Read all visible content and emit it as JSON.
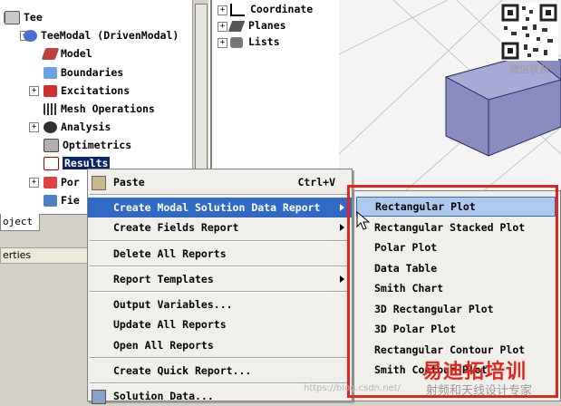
{
  "tree": {
    "items": [
      {
        "label": "Tee",
        "icon": "project-icon"
      },
      {
        "label": "TeeModal (DrivenModal)",
        "icon": "design-icon"
      },
      {
        "label": "Model",
        "icon": "model-icon"
      },
      {
        "label": "Boundaries",
        "icon": "boundaries-icon"
      },
      {
        "label": "Excitations",
        "icon": "excitations-icon"
      },
      {
        "label": "Mesh Operations",
        "icon": "mesh-icon"
      },
      {
        "label": "Analysis",
        "icon": "analysis-icon"
      },
      {
        "label": "Optimetrics",
        "icon": "optimetrics-icon"
      },
      {
        "label": "Results",
        "icon": "results-icon"
      },
      {
        "label": "Por",
        "icon": "port-icon"
      },
      {
        "label": "Fie",
        "icon": "field-icon"
      }
    ],
    "tab_label": "oject",
    "properties_label": "erties"
  },
  "middle": {
    "items": [
      {
        "label": "Coordinate",
        "icon": "coordinate-icon"
      },
      {
        "label": "Planes",
        "icon": "planes-icon"
      },
      {
        "label": "Lists",
        "icon": "lists-icon"
      }
    ]
  },
  "context_menu": {
    "items": [
      {
        "label": "Paste",
        "shortcut": "Ctrl+V"
      },
      {
        "label": "Create Modal Solution Data Report",
        "shortcut": ""
      },
      {
        "label": "Create Fields Report",
        "shortcut": ""
      },
      {
        "label": "Delete All Reports",
        "shortcut": ""
      },
      {
        "label": "Report Templates",
        "shortcut": ""
      },
      {
        "label": "Output Variables...",
        "shortcut": ""
      },
      {
        "label": "Update All Reports",
        "shortcut": ""
      },
      {
        "label": "Open All Reports",
        "shortcut": ""
      },
      {
        "label": "Create Quick Report...",
        "shortcut": ""
      },
      {
        "label": "Solution Data...",
        "shortcut": ""
      }
    ]
  },
  "submenu": {
    "items": [
      "Rectangular Plot",
      "Rectangular Stacked Plot",
      "Polar Plot",
      "Data Table",
      "Smith Chart",
      "3D Rectangular Plot",
      "3D Polar Plot",
      "Rectangular Contour Plot",
      "Smith Contour Plot"
    ]
  },
  "overlay": {
    "qr_caption": "微信联系",
    "watermark_main": "易迪拓培训",
    "watermark_sub": "射频和天线设计专家",
    "watermark_url": "https://blog.csdn.net/"
  },
  "colors": {
    "highlight": "#316ac5",
    "submenu_highlight": "#aecaf0",
    "annotation_red": "#e0261e",
    "box_face": "#8a8cc0"
  }
}
